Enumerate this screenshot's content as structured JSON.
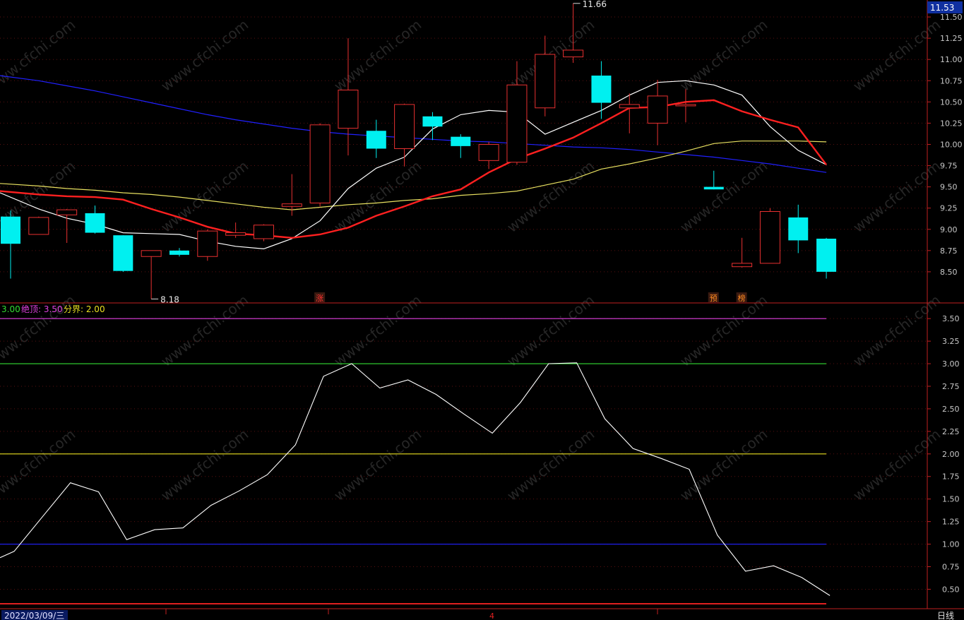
{
  "price_badge": "11.53",
  "period_label": "日线",
  "date_label": "2022/03/09/三",
  "month_marker": "4",
  "watermark": "www.cfchi.com",
  "indicator_legend": [
    {
      "text": "3.00",
      "color": "#33dd33"
    },
    {
      "text": "绝顶: 3.50",
      "color": "#e040e0"
    },
    {
      "text": "分界: 2.00",
      "color": "#e8e020"
    }
  ],
  "colors": {
    "up": "#e83030",
    "down": "#00f0f0",
    "ma5": "#ffffff",
    "ma10": "#ff2020",
    "ma20": "#e8e060",
    "ma60": "#2020ff"
  },
  "chart_data": [
    {
      "type": "candlestick",
      "y_ticks": [
        "11.50",
        "11.25",
        "11.00",
        "10.75",
        "10.50",
        "10.25",
        "10.00",
        "9.75",
        "9.50",
        "9.25",
        "9.00",
        "8.75",
        "8.50"
      ],
      "ylim": [
        8.15,
        11.7
      ],
      "high_annotation": "11.66",
      "low_annotation": "8.18",
      "candles": [
        {
          "o": 9.15,
          "h": 9.22,
          "l": 8.42,
          "c": 8.83
        },
        {
          "o": 8.94,
          "h": 9.15,
          "l": 8.94,
          "c": 9.14
        },
        {
          "o": 9.17,
          "h": 9.24,
          "l": 8.84,
          "c": 9.23
        },
        {
          "o": 9.19,
          "h": 9.28,
          "l": 8.95,
          "c": 8.96
        },
        {
          "o": 8.93,
          "h": 8.93,
          "l": 8.5,
          "c": 8.51
        },
        {
          "o": 8.68,
          "h": 8.75,
          "l": 8.18,
          "c": 8.75
        },
        {
          "o": 8.75,
          "h": 8.78,
          "l": 8.68,
          "c": 8.7
        },
        {
          "o": 8.68,
          "h": 9.0,
          "l": 8.63,
          "c": 8.98
        },
        {
          "o": 8.93,
          "h": 9.08,
          "l": 8.9,
          "c": 8.96
        },
        {
          "o": 8.89,
          "h": 9.06,
          "l": 8.86,
          "c": 9.05
        },
        {
          "o": 9.27,
          "h": 9.65,
          "l": 9.16,
          "c": 9.3
        },
        {
          "o": 9.31,
          "h": 10.25,
          "l": 9.27,
          "c": 10.23
        },
        {
          "o": 10.19,
          "h": 11.25,
          "l": 9.87,
          "c": 10.64
        },
        {
          "o": 10.16,
          "h": 10.29,
          "l": 9.84,
          "c": 9.95
        },
        {
          "o": 9.95,
          "h": 10.48,
          "l": 9.74,
          "c": 10.47
        },
        {
          "o": 10.33,
          "h": 10.38,
          "l": 10.05,
          "c": 10.21
        },
        {
          "o": 10.09,
          "h": 10.12,
          "l": 9.84,
          "c": 9.98
        },
        {
          "o": 9.81,
          "h": 10.03,
          "l": 9.71,
          "c": 10.0
        },
        {
          "o": 9.79,
          "h": 10.98,
          "l": 9.76,
          "c": 10.7
        },
        {
          "o": 10.43,
          "h": 11.28,
          "l": 10.33,
          "c": 11.06
        },
        {
          "o": 11.03,
          "h": 11.66,
          "l": 10.96,
          "c": 11.11
        },
        {
          "o": 10.81,
          "h": 10.98,
          "l": 10.3,
          "c": 10.49
        },
        {
          "o": 10.43,
          "h": 10.6,
          "l": 10.13,
          "c": 10.47
        },
        {
          "o": 10.25,
          "h": 10.76,
          "l": 9.99,
          "c": 10.57
        },
        {
          "o": 10.47,
          "h": 10.65,
          "l": 10.26,
          "c": 10.47
        },
        {
          "o": 9.5,
          "h": 9.69,
          "l": 9.47,
          "c": 9.47
        },
        {
          "o": 8.56,
          "h": 8.9,
          "l": 8.55,
          "c": 8.6
        },
        {
          "o": 8.6,
          "h": 9.25,
          "l": 8.6,
          "c": 9.21
        },
        {
          "o": 9.14,
          "h": 9.29,
          "l": 8.72,
          "c": 8.87
        },
        {
          "o": 8.89,
          "h": 8.9,
          "l": 8.42,
          "c": 8.5
        }
      ],
      "ma5": [
        9.43,
        9.24,
        9.13,
        9.06,
        8.96,
        8.95,
        8.94,
        8.86,
        8.8,
        8.77,
        8.89,
        9.1,
        9.48,
        9.72,
        9.85,
        10.18,
        10.35,
        10.4,
        10.38,
        10.12,
        10.26,
        10.4,
        10.58,
        10.73,
        10.75,
        10.7,
        10.58,
        10.21,
        9.93,
        9.76
      ],
      "ma10": [
        9.45,
        9.41,
        9.39,
        9.38,
        9.35,
        9.24,
        9.14,
        9.03,
        8.95,
        8.93,
        8.9,
        8.94,
        9.02,
        9.16,
        9.27,
        9.39,
        9.47,
        9.67,
        9.83,
        9.95,
        10.08,
        10.25,
        10.43,
        10.44,
        10.5,
        10.52,
        10.39,
        10.29,
        10.2,
        9.76
      ],
      "ma20": [
        9.54,
        9.51,
        9.48,
        9.46,
        9.43,
        9.41,
        9.38,
        9.34,
        9.3,
        9.26,
        9.23,
        9.26,
        9.29,
        9.31,
        9.34,
        9.36,
        9.4,
        9.42,
        9.45,
        9.52,
        9.59,
        9.71,
        9.77,
        9.84,
        9.92,
        10.01,
        10.04,
        10.04,
        10.04,
        10.03
      ],
      "ma60": [
        10.81,
        10.75,
        10.69,
        10.63,
        10.56,
        10.49,
        10.42,
        10.35,
        10.29,
        10.24,
        10.19,
        10.15,
        10.12,
        10.1,
        10.08,
        10.06,
        10.04,
        10.03,
        10.01,
        9.99,
        9.97,
        9.96,
        9.94,
        9.91,
        9.88,
        9.85,
        9.81,
        9.77,
        9.72,
        9.67
      ],
      "markers": [
        {
          "index": 11,
          "text": "涨",
          "color": "#ff3030"
        },
        {
          "index": 25,
          "text": "预",
          "color": "#ff8a20"
        },
        {
          "index": 26,
          "text": "榜",
          "color": "#ff8a20"
        }
      ]
    },
    {
      "type": "line",
      "y_ticks": [
        "3.50",
        "3.25",
        "3.00",
        "2.75",
        "2.50",
        "2.25",
        "2.00",
        "1.75",
        "1.50",
        "1.25",
        "1.00",
        "0.75",
        "0.50"
      ],
      "ylim": [
        0.3,
        3.65
      ],
      "reference_lines": [
        {
          "value": 3.5,
          "color": "#e040e0"
        },
        {
          "value": 3.0,
          "color": "#33dd33"
        },
        {
          "value": 2.0,
          "color": "#e8e020"
        },
        {
          "value": 1.0,
          "color": "#2020ff"
        }
      ],
      "values": [
        0.85,
        0.92,
        1.3,
        1.68,
        1.58,
        1.05,
        1.16,
        1.18,
        1.43,
        1.59,
        1.77,
        2.1,
        2.86,
        3.0,
        2.73,
        2.82,
        2.66,
        2.44,
        2.23,
        2.57,
        3.0,
        3.01,
        2.39,
        2.06,
        1.95,
        1.83,
        1.1,
        0.7,
        0.76,
        0.63,
        0.43
      ]
    }
  ]
}
